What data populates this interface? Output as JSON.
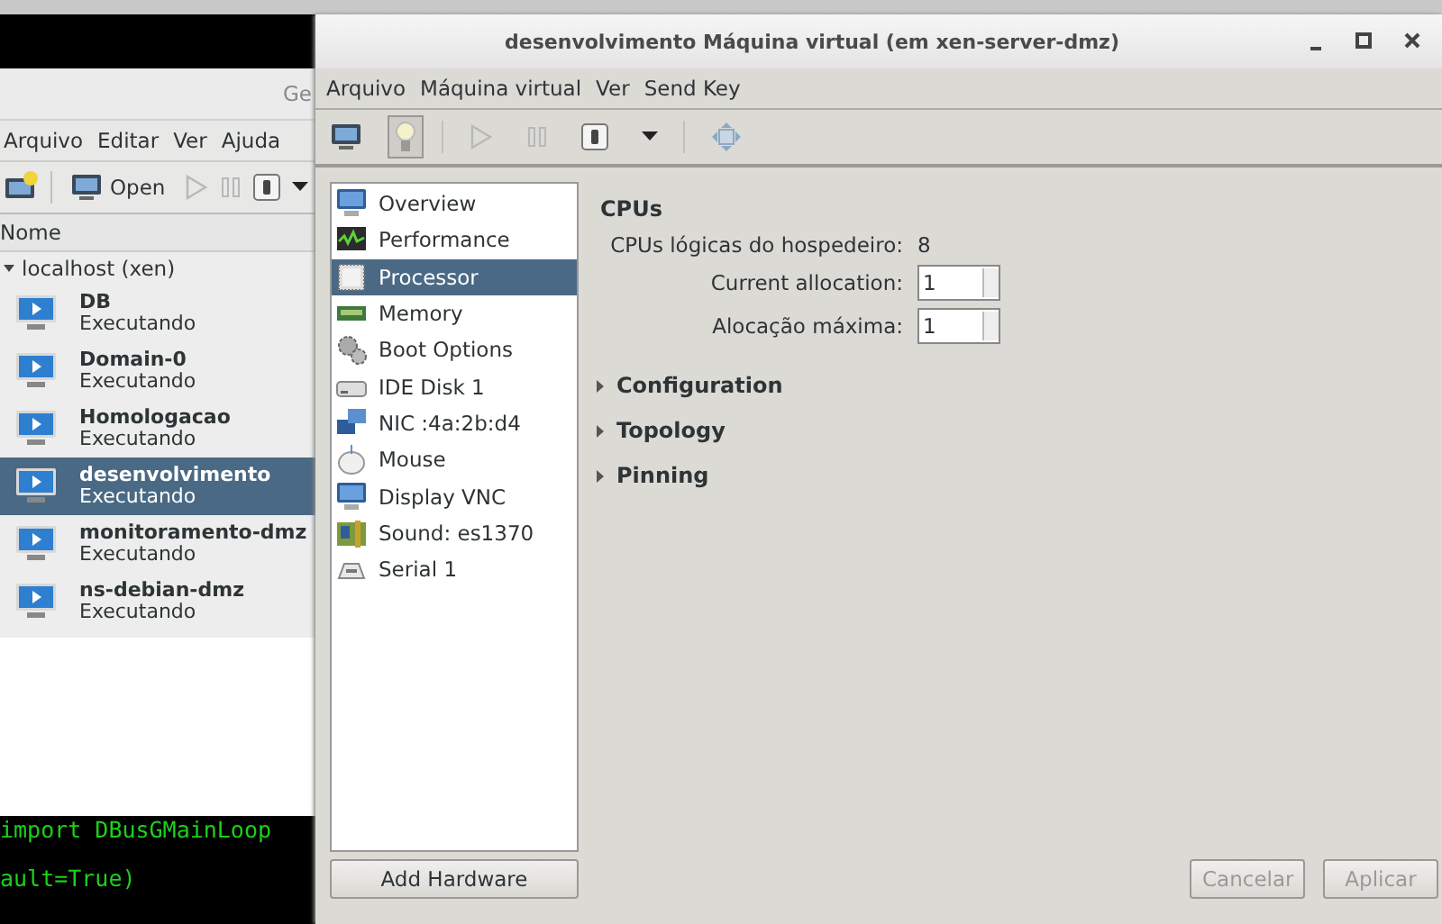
{
  "terminal": {
    "lines": [
      "import DBusGMainLoop",
      "ault=True)"
    ]
  },
  "manager": {
    "title": "Ge",
    "menu": [
      "Arquivo",
      "Editar",
      "Ver",
      "Ajuda"
    ],
    "toolbar": [
      {
        "kind": "new"
      },
      {
        "kind": "open",
        "label": "Open"
      },
      {
        "kind": "run",
        "disabled": true
      },
      {
        "kind": "pause",
        "disabled": true
      },
      {
        "kind": "shutdown"
      },
      {
        "kind": "dropdown"
      }
    ],
    "column": "Nome",
    "host": {
      "label": "localhost (xen)",
      "expanded": true,
      "children": [
        {
          "name": "DB",
          "status": "Executando",
          "selected": false
        },
        {
          "name": "Domain-0",
          "status": "Executando",
          "selected": false
        },
        {
          "name": "Homologacao",
          "status": "Executando",
          "selected": false
        },
        {
          "name": "desenvolvimento",
          "status": "Executando",
          "selected": true
        },
        {
          "name": "monitoramento-dmz",
          "status": "Executando",
          "selected": false
        },
        {
          "name": "ns-debian-dmz",
          "status": "Executando",
          "selected": false
        }
      ]
    }
  },
  "dialog": {
    "title": "desenvolvimento Máquina virtual (em xen-server-dmz)",
    "menu": [
      "Arquivo",
      "Máquina virtual",
      "Ver",
      "Send Key"
    ],
    "toolbar": [
      {
        "kind": "console",
        "selected": false
      },
      {
        "kind": "details",
        "selected": true
      },
      {
        "kind": "run",
        "selected": false,
        "disabled": true
      },
      {
        "kind": "pause",
        "selected": false,
        "disabled": true
      },
      {
        "kind": "shutdown",
        "selected": false
      },
      {
        "kind": "dropdown",
        "selected": false
      },
      {
        "kind": "fullscreen",
        "selected": false
      }
    ],
    "hardware": [
      {
        "label": "Overview",
        "kind": "monitor",
        "selected": false
      },
      {
        "label": "Performance",
        "kind": "graph",
        "selected": false
      },
      {
        "label": "Processor",
        "kind": "chip",
        "selected": true
      },
      {
        "label": "Memory",
        "kind": "ram",
        "selected": false
      },
      {
        "label": "Boot Options",
        "kind": "gears",
        "selected": false
      },
      {
        "label": "IDE Disk 1",
        "kind": "disk",
        "selected": false
      },
      {
        "label": "NIC :4a:2b:d4",
        "kind": "network",
        "selected": false
      },
      {
        "label": "Mouse",
        "kind": "mouse",
        "selected": false
      },
      {
        "label": "Display VNC",
        "kind": "monitor",
        "selected": false
      },
      {
        "label": "Sound: es1370",
        "kind": "sound",
        "selected": false
      },
      {
        "label": "Serial 1",
        "kind": "serial",
        "selected": false
      }
    ],
    "add_hardware": "Add Hardware",
    "section_title": "CPUs",
    "host_cpus": {
      "label": "CPUs lógicas do hospedeiro:",
      "value": "8"
    },
    "fields": [
      {
        "label": "Current allocation:",
        "value": "1"
      },
      {
        "label": "Alocação máxima:",
        "value": "1"
      }
    ],
    "expanders": [
      {
        "label": "Configuration",
        "expanded": false
      },
      {
        "label": "Topology",
        "expanded": false
      },
      {
        "label": "Pinning",
        "expanded": false
      }
    ],
    "buttons": [
      {
        "label": "Cancelar",
        "disabled": true
      },
      {
        "label": "Aplicar",
        "disabled": true
      }
    ]
  }
}
